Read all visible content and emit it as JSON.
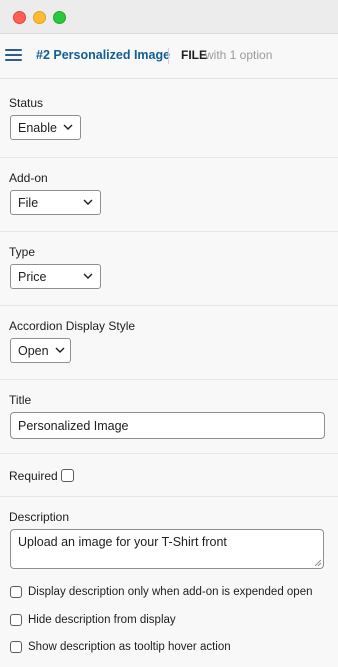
{
  "header": {
    "title": "#2 Personalized Image",
    "type": "FILE",
    "options": "with 1 option"
  },
  "status": {
    "label": "Status",
    "value": "Enable"
  },
  "addon": {
    "label": "Add-on",
    "value": "File"
  },
  "type": {
    "label": "Type",
    "value": "Price"
  },
  "accordion": {
    "label": "Accordion Display Style",
    "value": "Open"
  },
  "title": {
    "label": "Title",
    "value": "Personalized Image"
  },
  "required": {
    "label": "Required",
    "checked": false
  },
  "description": {
    "label": "Description",
    "value": "Upload an image for your T-Shirt front"
  },
  "options": {
    "display_only_expanded": "Display description only when add-on is expended open",
    "hide_description": "Hide description from display",
    "show_tooltip": "Show description as tooltip hover action"
  },
  "colors": {
    "accent": "#135e96",
    "border": "#8c8f94",
    "background": "#f8f8f8"
  }
}
